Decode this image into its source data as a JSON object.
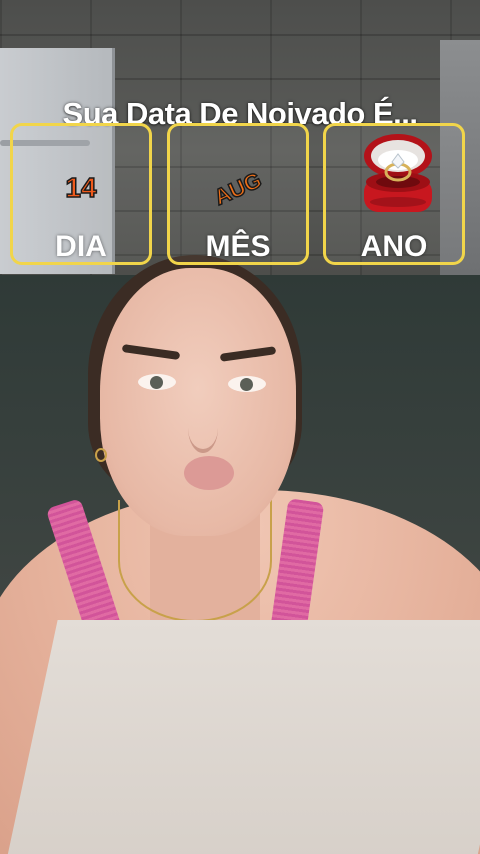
{
  "overlay": {
    "title": "Sua Data De Noivado É...",
    "cards": [
      {
        "label": "DIA",
        "value": "14"
      },
      {
        "label": "MÊS",
        "value": "AUG"
      },
      {
        "label": "ANO",
        "icon": "ring-box-icon"
      }
    ]
  },
  "colors": {
    "card_border": "#f1d54a",
    "value_orange": "#ee5a1c",
    "ring_box_red": "#c8171f"
  }
}
